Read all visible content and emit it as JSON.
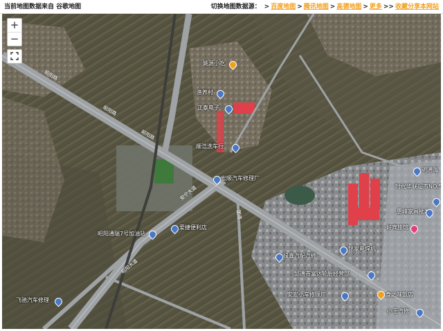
{
  "header": {
    "source_text": "当前地图数据来自 谷歌地图",
    "switch_label": "切换地图数据源：",
    "links": [
      "百度地图",
      "腾讯地图",
      "高德地图",
      "更多",
      "收藏分享本网站"
    ]
  },
  "controls": {
    "zoom_in": "+",
    "zoom_out": "−"
  },
  "colors": {
    "link": "#f2a01e",
    "road": "#9fa3a6",
    "roof_red": "#e0404a",
    "field": "#5a5a48"
  },
  "labels": [
    {
      "text": "姚源小吃",
      "color": "orange"
    },
    {
      "text": "渔养村",
      "color": "blue"
    },
    {
      "text": "正泰电子",
      "color": "blue"
    },
    {
      "text": "顺浩洗车行",
      "color": "blue"
    },
    {
      "text": "宏顺汽车修理厂",
      "color": "blue"
    },
    {
      "text": "昭阳通瑞7号加油站",
      "color": "blue"
    },
    {
      "text": "爱捷便利店",
      "color": "blue"
    },
    {
      "text": "明通海",
      "color": "blue"
    },
    {
      "text": "时代华联超市NO.5",
      "color": "blue"
    },
    {
      "text": "惠峰家具批发",
      "color": "blue"
    },
    {
      "text": "好宾旅馆",
      "color": "pink"
    },
    {
      "text": "铭家电焊机",
      "color": "blue"
    },
    {
      "text": "绿鑫汽配汽修",
      "color": "blue"
    },
    {
      "text": "邱通市富达轮胎经营部",
      "color": "blue"
    },
    {
      "text": "安宏小车修理厂",
      "color": "blue"
    },
    {
      "text": "食之味饭店",
      "color": "orange"
    },
    {
      "text": "飞驰汽车修理",
      "color": "blue"
    },
    {
      "text": "小王汽修",
      "color": "blue"
    }
  ],
  "roads": [
    "昭阳路",
    "昭阳路",
    "昭阳路",
    "国道",
    "安宁大道",
    "昭阳大道"
  ]
}
